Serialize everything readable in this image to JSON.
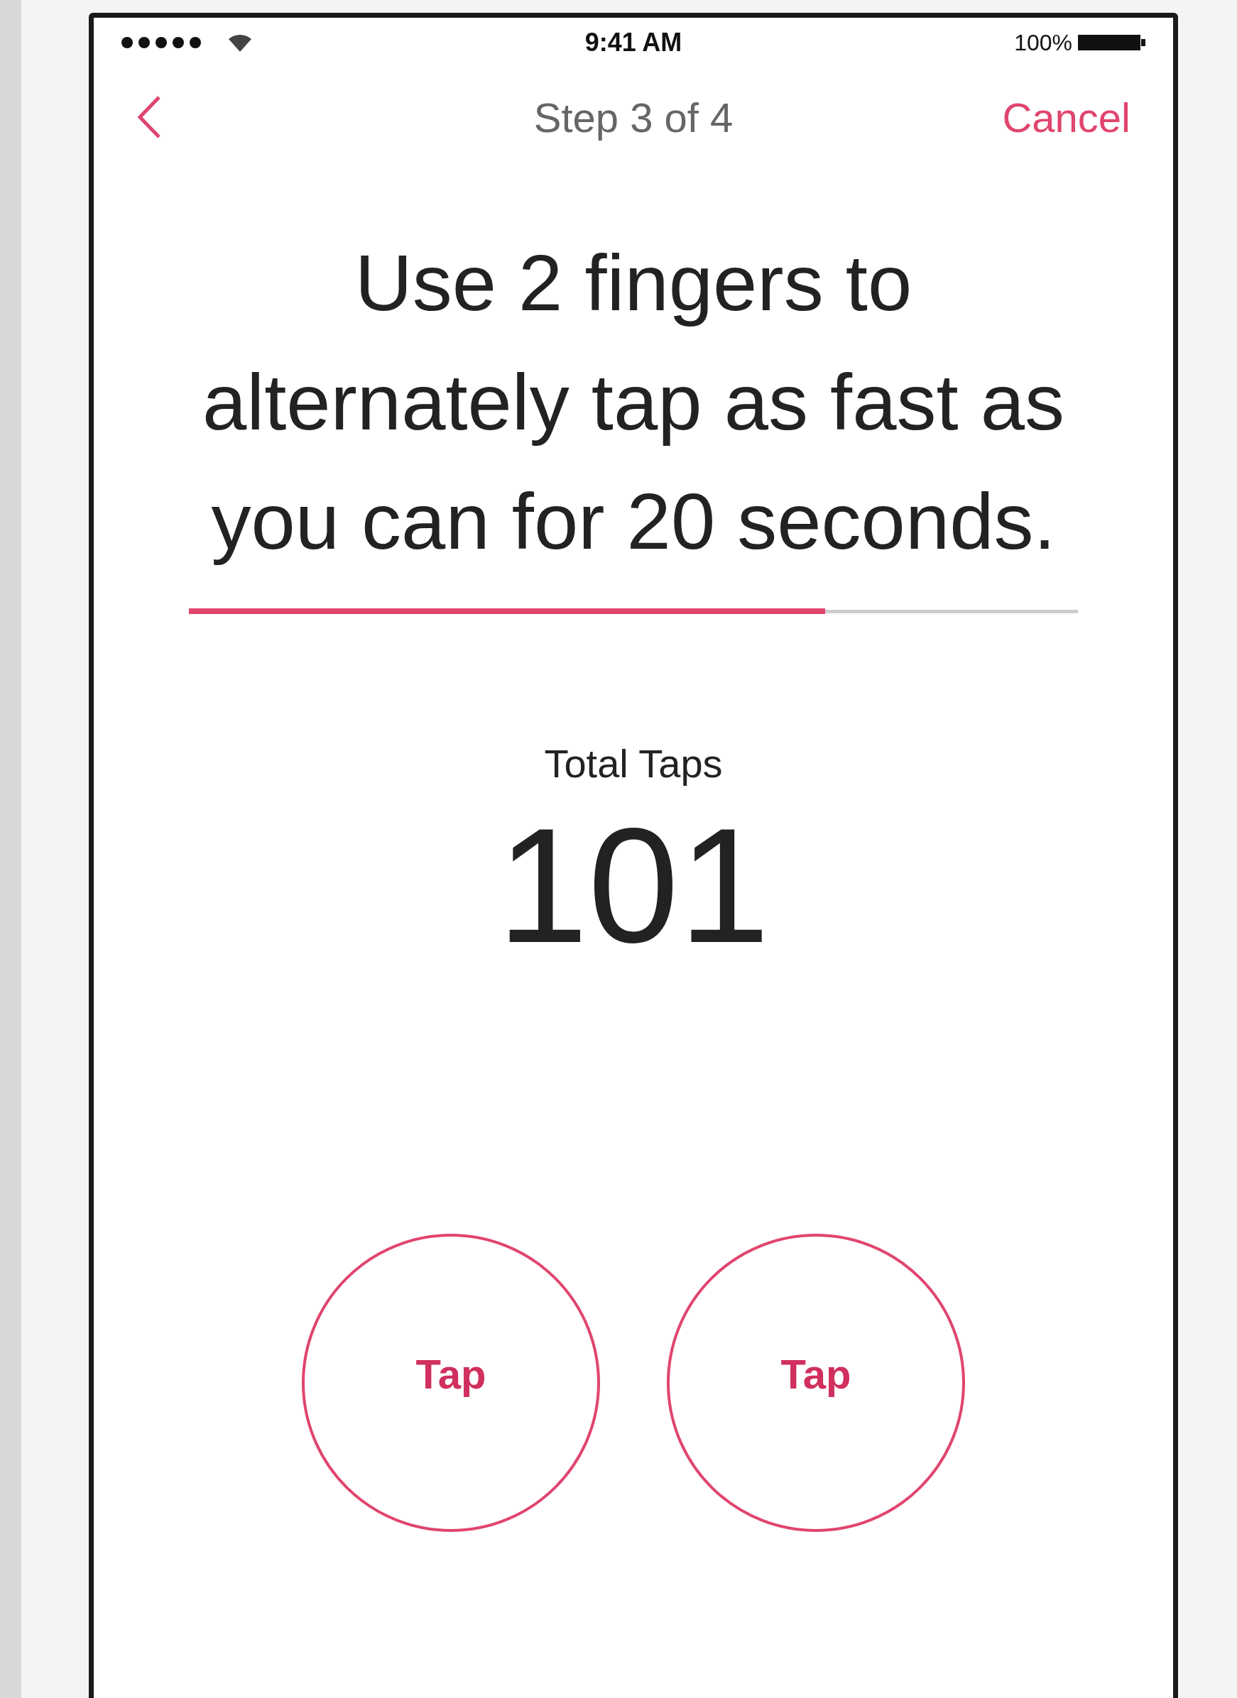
{
  "status_bar": {
    "time": "9:41 AM",
    "battery": "100%"
  },
  "nav": {
    "title": "Step 3 of 4",
    "cancel": "Cancel"
  },
  "instruction": "Use 2 fingers to alternately tap as fast as you can for 20 seconds.",
  "progress": {
    "level": 0.716
  },
  "counter": {
    "label": "Total Taps",
    "value": "101"
  },
  "tap_buttons": [
    {
      "label": "Tap"
    },
    {
      "label": "Tap"
    }
  ]
}
